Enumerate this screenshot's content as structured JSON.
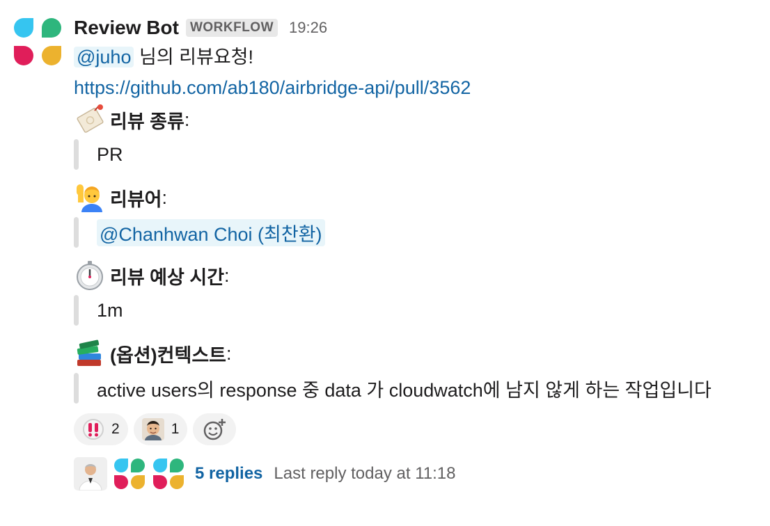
{
  "message": {
    "sender": "Review Bot",
    "badge": "WORKFLOW",
    "time": "19:26",
    "mention": "@juho",
    "request_text": "님의 리뷰요청!",
    "pr_link": "https://github.com/ab180/airbridge-api/pull/3562",
    "sections": [
      {
        "title": "리뷰 종류",
        "value": "PR",
        "icon": "tag-icon"
      },
      {
        "title": "리뷰어",
        "value": "@Chanhwan Choi (최찬환)",
        "icon": "raising-hand-icon"
      },
      {
        "title": "리뷰 예상 시간",
        "value": "1m",
        "icon": "stopwatch-icon"
      },
      {
        "title": "(옵션)컨텍스트",
        "value": "active users의 response 중 data 가 cloudwatch에 남지 않게 하는 작업입니다",
        "icon": "books-icon"
      }
    ],
    "colon": ":"
  },
  "reactions": [
    {
      "icon": "exclamation-emoji-icon",
      "count": "2"
    },
    {
      "icon": "person-face-emoji-icon",
      "count": "1"
    }
  ],
  "thread": {
    "replies": "5 replies",
    "last_reply": "Last reply today at 11:18"
  },
  "colors": {
    "blue": "#36c5f0",
    "green": "#2eb67d",
    "red": "#e01e5a",
    "yellow": "#ecb22e",
    "link": "#1264a3"
  }
}
